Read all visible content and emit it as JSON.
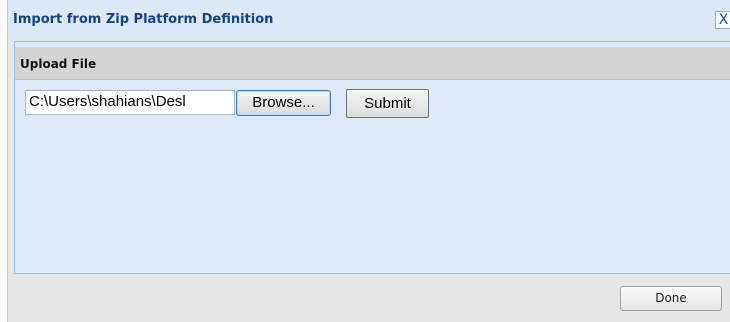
{
  "dialog": {
    "title": "Import from Zip Platform Definition",
    "close_glyph": "X"
  },
  "upload": {
    "section_title": "Upload File",
    "file_path_value": "C:\\Users\\shahians\\Desl",
    "browse_label": "Browse...",
    "submit_label": "Submit"
  },
  "footer": {
    "done_label": "Done"
  }
}
